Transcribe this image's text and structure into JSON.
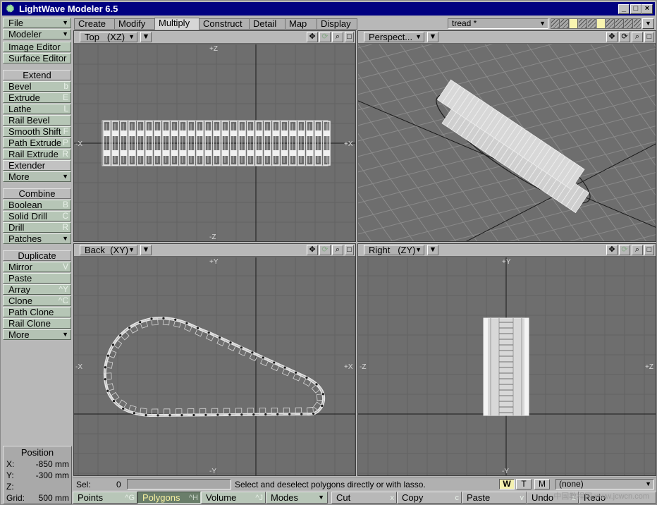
{
  "app": {
    "title": "LightWave Modeler 6.5"
  },
  "sidebar": {
    "menus": [
      {
        "label": "File"
      },
      {
        "label": "Modeler"
      }
    ],
    "editors": [
      {
        "label": "Image Editor"
      },
      {
        "label": "Surface Editor"
      }
    ],
    "groups": [
      {
        "header": "Extend",
        "items": [
          {
            "label": "Bevel",
            "key": "b"
          },
          {
            "label": "Extrude",
            "key": "E"
          },
          {
            "label": "Lathe",
            "key": "L"
          },
          {
            "label": "Rail Bevel",
            "key": ""
          },
          {
            "label": "Smooth Shift",
            "key": "F"
          },
          {
            "label": "Path Extrude",
            "key": "P"
          },
          {
            "label": "Rail Extrude",
            "key": "R"
          },
          {
            "label": "Extender",
            "key": ""
          }
        ],
        "more": "More"
      },
      {
        "header": "Combine",
        "items": [
          {
            "label": "Boolean",
            "key": "B"
          },
          {
            "label": "Solid Drill",
            "key": "C"
          },
          {
            "label": "Drill",
            "key": "R"
          }
        ],
        "more": "Patches"
      },
      {
        "header": "Duplicate",
        "items": [
          {
            "label": "Mirror",
            "key": "V"
          },
          {
            "label": "Paste",
            "key": ""
          },
          {
            "label": "Array",
            "key": "^Y"
          },
          {
            "label": "Clone",
            "key": "^C"
          },
          {
            "label": "Path Clone",
            "key": ""
          },
          {
            "label": "Rail Clone",
            "key": ""
          }
        ],
        "more": "More"
      }
    ]
  },
  "position": {
    "title": "Position",
    "rows": [
      {
        "axis": "X:",
        "value": "-850 mm"
      },
      {
        "axis": "Y:",
        "value": "-300 mm"
      },
      {
        "axis": "Z:",
        "value": ""
      },
      {
        "axis": "Grid:",
        "value": "500 mm"
      }
    ]
  },
  "tabs": [
    {
      "label": "Create"
    },
    {
      "label": "Modify"
    },
    {
      "label": "Multiply",
      "active": true
    },
    {
      "label": "Construct"
    },
    {
      "label": "Detail"
    },
    {
      "label": "Map"
    },
    {
      "label": "Display"
    }
  ],
  "layer_object": "tread *",
  "viewports": {
    "top": {
      "name": "Top",
      "axes": "(XZ)",
      "labels": {
        "up": "+Z",
        "down": "-Z",
        "left": "-X",
        "right": "+X"
      }
    },
    "persp": {
      "name": "Perspect..."
    },
    "back": {
      "name": "Back",
      "axes": "(XY)",
      "labels": {
        "up": "+Y",
        "down": "-Y",
        "left": "-X",
        "right": "+X"
      }
    },
    "right": {
      "name": "Right",
      "axes": "(ZY)",
      "labels": {
        "up": "+Y",
        "down": "-Y",
        "left": "-Z",
        "right": "+Z"
      }
    }
  },
  "icons": {
    "move": "move-icon",
    "rotate": "rotate-icon",
    "zoom": "magnifier-icon"
  },
  "status": {
    "sel_label": "Sel:",
    "sel_value": "0",
    "message": "Select and deselect polygons directly or with lasso.",
    "wtm": [
      "W",
      "T",
      "M"
    ],
    "surface": "(none)"
  },
  "bottom": [
    {
      "label": "Points",
      "key": "^G"
    },
    {
      "label": "Polygons",
      "key": "^H",
      "active": true
    },
    {
      "label": "Volume",
      "key": "^J"
    },
    {
      "label": "Modes",
      "dropdown": true
    },
    {
      "label": "Cut",
      "key": "x"
    },
    {
      "label": "Copy",
      "key": "c"
    },
    {
      "label": "Paste",
      "key": "v"
    },
    {
      "label": "Undo",
      "key": "z"
    },
    {
      "label": "Redo",
      "key": ""
    }
  ],
  "watermark": "中国教程网 www.jcwcn.com",
  "colors": {
    "titlebar": "#000080",
    "viewport": "#6e6e6e",
    "button": "#b6c6b6",
    "active_mode": "#6a7e6a",
    "wire": "#e8e8e8"
  }
}
